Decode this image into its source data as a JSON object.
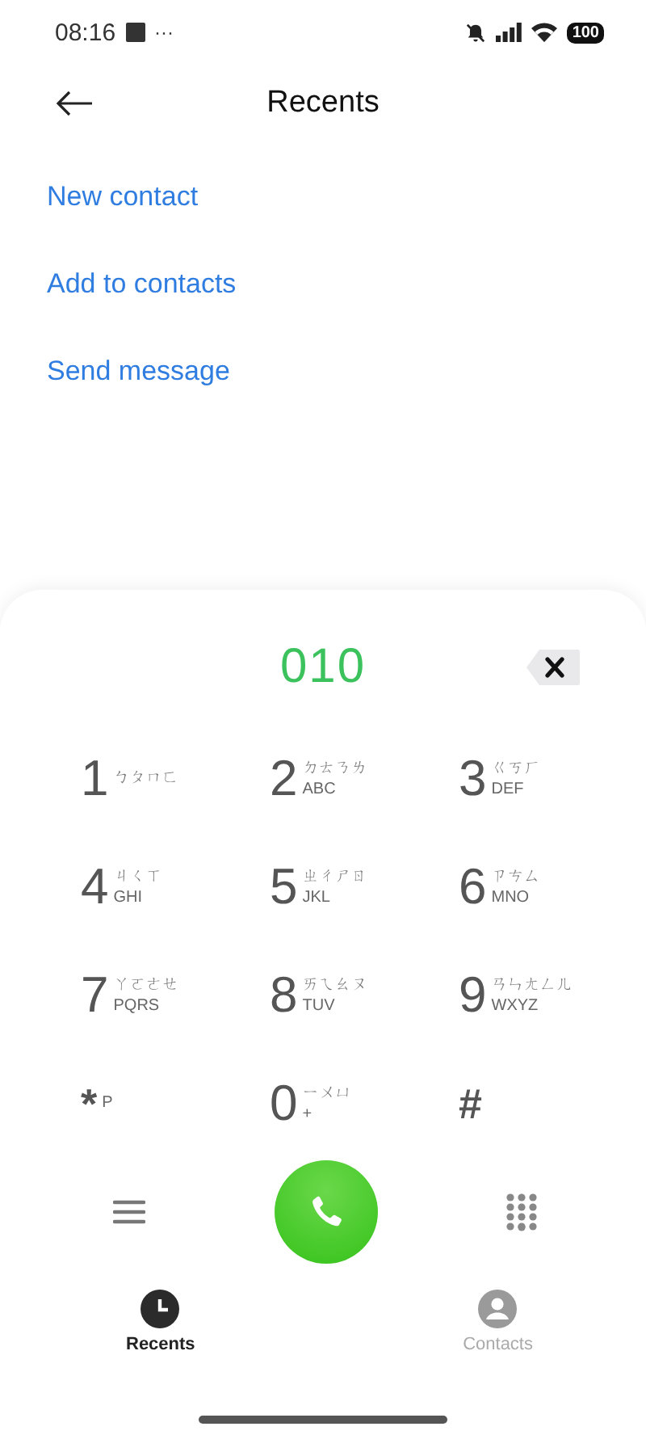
{
  "status_bar": {
    "time": "08:16",
    "overflow": "···",
    "battery": "100"
  },
  "header": {
    "title": "Recents"
  },
  "actions": [
    {
      "label": "New contact"
    },
    {
      "label": "Add to contacts"
    },
    {
      "label": "Send message"
    }
  ],
  "dialpad": {
    "number": "010",
    "keys": [
      {
        "digit": "1",
        "bopomofo": "ㄅㄆㄇㄈ"
      },
      {
        "digit": "2",
        "bopomofo": "ㄉㄊㄋㄌ",
        "letters": "ABC"
      },
      {
        "digit": "3",
        "bopomofo": "ㄍㄎㄏ",
        "letters": "DEF"
      },
      {
        "digit": "4",
        "bopomofo": "ㄐㄑㄒ",
        "letters": "GHI"
      },
      {
        "digit": "5",
        "bopomofo": "ㄓㄔㄕㄖ",
        "letters": "JKL"
      },
      {
        "digit": "6",
        "bopomofo": "ㄗㄘㄙ",
        "letters": "MNO"
      },
      {
        "digit": "7",
        "bopomofo": "ㄚㄛㄜㄝ",
        "letters": "PQRS"
      },
      {
        "digit": "8",
        "bopomofo": "ㄞㄟㄠㄡ",
        "letters": "TUV"
      },
      {
        "digit": "9",
        "bopomofo": "ㄢㄣㄤㄥㄦ",
        "letters": "WXYZ"
      },
      {
        "digit": "*",
        "letters": "P"
      },
      {
        "digit": "0",
        "bopomofo": "ㄧㄨㄩ",
        "letters": "+"
      },
      {
        "digit": "#"
      }
    ]
  },
  "tabs": [
    {
      "kind": "recents",
      "label": "Recents",
      "selected": true
    },
    {
      "kind": "contacts",
      "label": "Contacts",
      "selected": false
    }
  ]
}
